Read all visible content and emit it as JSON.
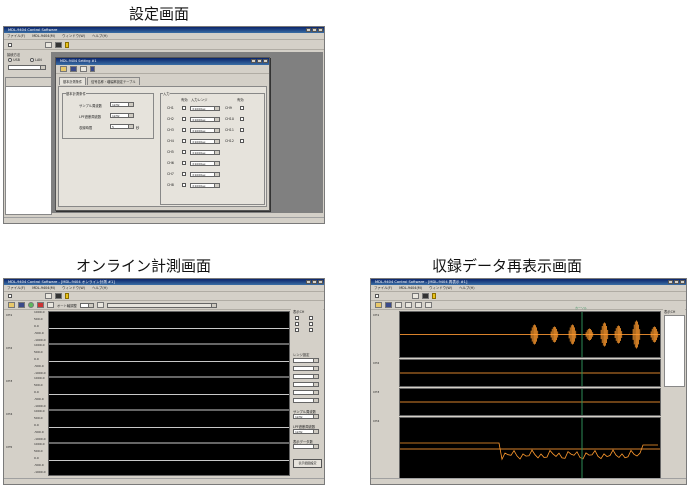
{
  "captions": {
    "settings": "設定画面",
    "online": "オンライン計測画面",
    "playback": "収録データ再表示画面"
  },
  "app": {
    "title": "MDL-9404 Control Software",
    "menu": [
      "ファイル(F)",
      "MDL-9404(M)",
      "ウィンドウ(W)",
      "ヘルプ(H)"
    ]
  },
  "settings_screen": {
    "sub_title": "MDL-9404 Setting #1",
    "tabs": [
      "基本計測条件",
      "信号名称・増幅率設定テーブル"
    ],
    "group_basic": "基本計測条件",
    "group_input": "入力",
    "fields": [
      {
        "label": "サンプル周波数",
        "value": "1kHz"
      },
      {
        "label": "LPF遮断周波数",
        "value": "1kHz"
      },
      {
        "label": "収録時間",
        "value": "5",
        "unit": "秒"
      }
    ],
    "col_enable": "有効",
    "col_range": "入力レンジ",
    "channels_left": [
      "CH1",
      "CH2",
      "CH3",
      "CH4",
      "CH5",
      "CH6",
      "CH7",
      "CH8"
    ],
    "channels_right": [
      "CH9",
      "CH10",
      "CH11",
      "CH12"
    ],
    "range_value": "±1000µε",
    "left_panel_label": "接続方法",
    "left_options": [
      "USB",
      "LAN"
    ]
  },
  "online_screen": {
    "title": "MDL-9404 Control Software - [MDL-9404 オンライン計測 #1]",
    "tool_label": "オート軸調整",
    "ch_labels": [
      "CH1",
      "CH2",
      "CH3",
      "CH4",
      "CH5"
    ],
    "y_ticks": [
      "1000.0",
      "500.0",
      "0.0",
      "-500.0",
      "-1000.0"
    ],
    "x_ticks": [
      "0.0000",
      "0.5000",
      "1.0000",
      "1.5000",
      "2.0000",
      "2.5000"
    ],
    "right_items": [
      "表示CH",
      "レンジ設定",
      "サンプル周波数",
      "LPF遮断周波数",
      "表示データ数"
    ],
    "right_value": "1kHz",
    "button": "表示範囲設定"
  },
  "playback_screen": {
    "title": "MDL-9404 Control Software - [MDL-9404 再表示 #1]",
    "ch_labels": [
      "CH1",
      "CH2",
      "CH3",
      "CH4"
    ],
    "cursor_label": "カーソル",
    "right_header": "表示CH"
  }
}
